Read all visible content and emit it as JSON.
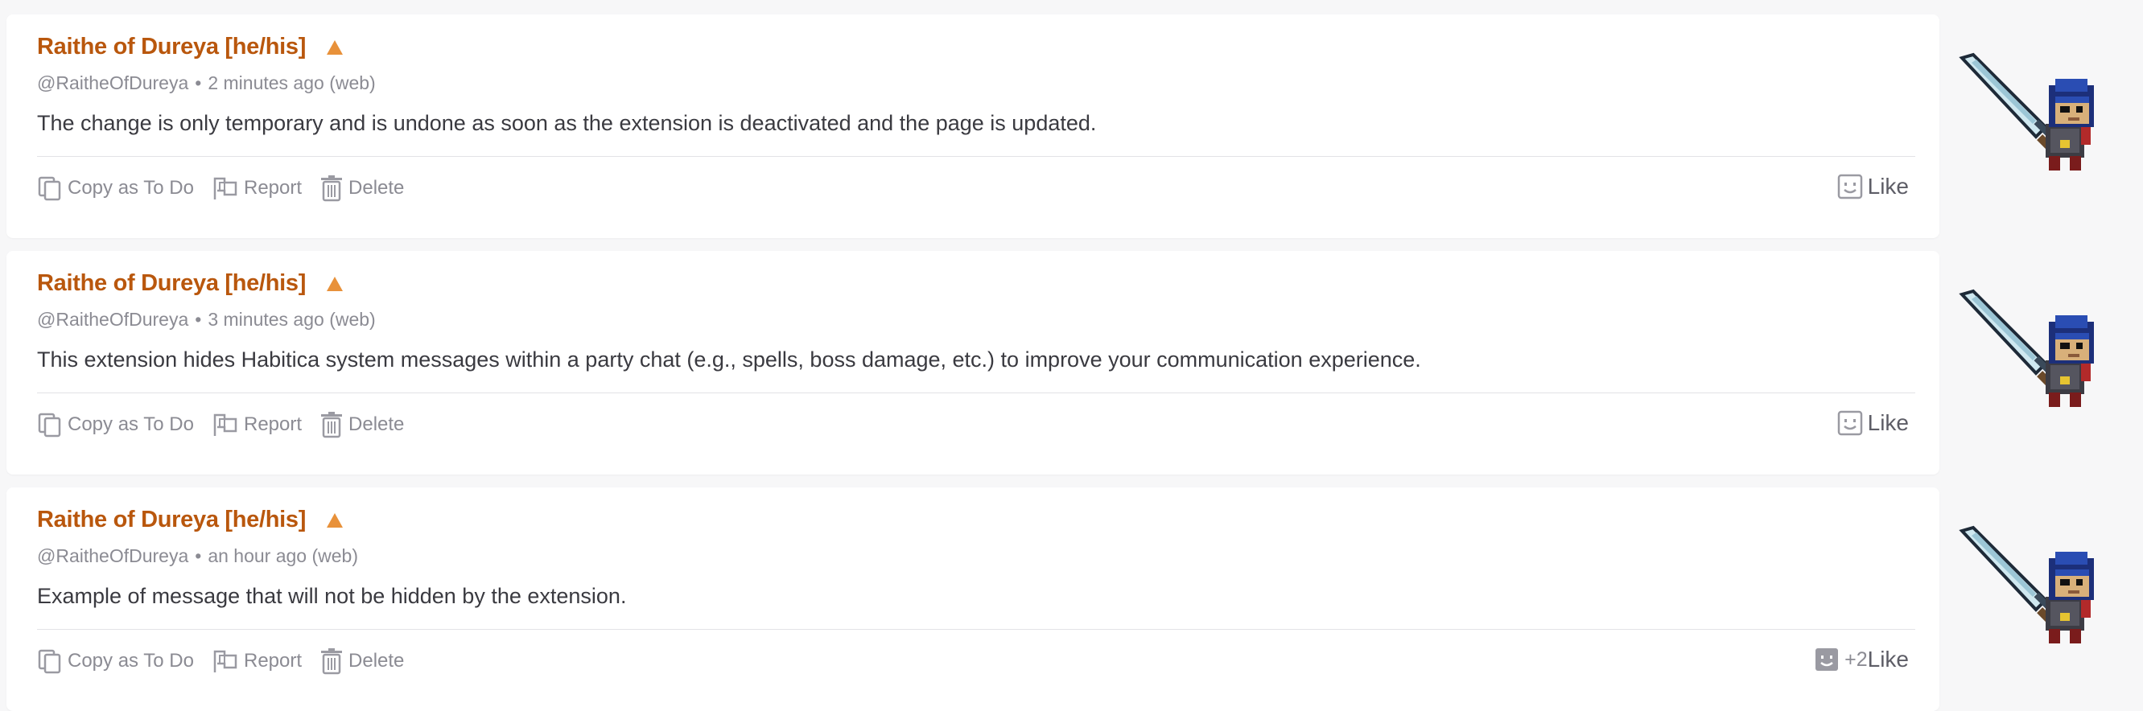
{
  "messages": [
    {
      "username": "Raithe of Dureya [he/his]",
      "handle": "@RaitheOfDureya",
      "separator": "•",
      "time": "2 minutes ago (web)",
      "text": "The change is only temporary and is undone as soon as the extension is deactivated and the page is updated.",
      "actions": {
        "copy": "Copy as To Do",
        "report": "Report",
        "delete": "Delete"
      },
      "like_label": "Like",
      "like_count": ""
    },
    {
      "username": "Raithe of Dureya [he/his]",
      "handle": "@RaitheOfDureya",
      "separator": "•",
      "time": "3 minutes ago (web)",
      "text": "This extension hides Habitica system messages within a party chat (e.g., spells, boss damage, etc.) to improve your communication experience.",
      "actions": {
        "copy": "Copy as To Do",
        "report": "Report",
        "delete": "Delete"
      },
      "like_label": "Like",
      "like_count": ""
    },
    {
      "username": "Raithe of Dureya [he/his]",
      "handle": "@RaitheOfDureya",
      "separator": "•",
      "time": "an hour ago (web)",
      "text": "Example of message that will not be hidden by the extension.",
      "actions": {
        "copy": "Copy as To Do",
        "report": "Report",
        "delete": "Delete"
      },
      "like_label": "Like",
      "like_count": "+2"
    }
  ],
  "colors": {
    "username": "#b9570d",
    "tier_icon": "#e8913a",
    "meta": "#8b8b93",
    "text": "#3a3a40",
    "background": "#f7f7f8",
    "card": "#ffffff"
  },
  "icons": {
    "tier": "triangle-up-icon",
    "copy": "copy-icon",
    "report": "flag-icon",
    "delete": "trash-icon",
    "like": "smiley-face-icon"
  }
}
